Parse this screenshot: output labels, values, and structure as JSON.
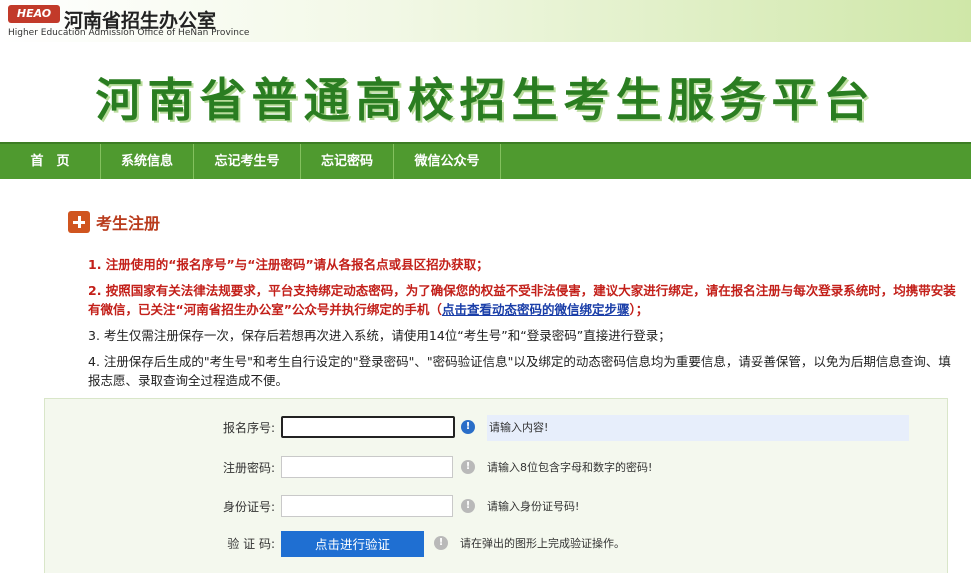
{
  "header": {
    "logo_badge": "HEAO",
    "office_name": "河南省招生办公室",
    "office_name_en": "Higher Education Admission Office of HeNan Province",
    "banner_title": "河南省普通高校招生考生服务平台"
  },
  "nav": {
    "items": [
      {
        "label": "首　页"
      },
      {
        "label": "系统信息"
      },
      {
        "label": "忘记考生号"
      },
      {
        "label": "忘记密码"
      },
      {
        "label": "微信公众号"
      }
    ]
  },
  "section": {
    "title": "考生注册"
  },
  "notes": {
    "n1": "1. 注册使用的“报名序号”与“注册密码”请从各报名点或县区招办获取；",
    "n2_text": "2. 按照国家有关法律法规要求，平台支持绑定动态密码，为了确保您的权益不受非法侵害，建议大家进行绑定，请在报名注册与每次登录系统时，均携带安装有微信，已关注“河南省招生办公室”公众号并执行绑定的手机（",
    "n2_link": "点击查看动态密码的微信绑定步骤",
    "n2_tail": "）；",
    "n3": "3. 考生仅需注册保存一次，保存后若想再次进入系统，请使用14位“考生号”和“登录密码”直接进行登录；",
    "n4": "4. 注册保存后生成的\"考生号\"和考生自行设定的\"登录密码\"、\"密码验证信息\"以及绑定的动态密码信息均为重要信息，请妥善保管，以免为后期信息查询、填报志愿、录取查询全过程造成不便。"
  },
  "form": {
    "reg_no": {
      "label": "报名序号:",
      "value": "",
      "hint": "请输入内容!"
    },
    "reg_password": {
      "label": "注册密码:",
      "value": "",
      "hint": "请输入8位包含字母和数字的密码!"
    },
    "id_card": {
      "label": "身份证号:",
      "value": "",
      "hint": "请输入身份证号码!"
    },
    "captcha": {
      "label": "验 证 码:",
      "button": "点击进行验证",
      "hint": "请在弹出的图形上完成验证操作。"
    }
  },
  "colors": {
    "nav_green": "#4f9a2f",
    "title_green": "#2a7d21",
    "note_red": "#c3201a",
    "button_blue": "#1f6fd2"
  }
}
